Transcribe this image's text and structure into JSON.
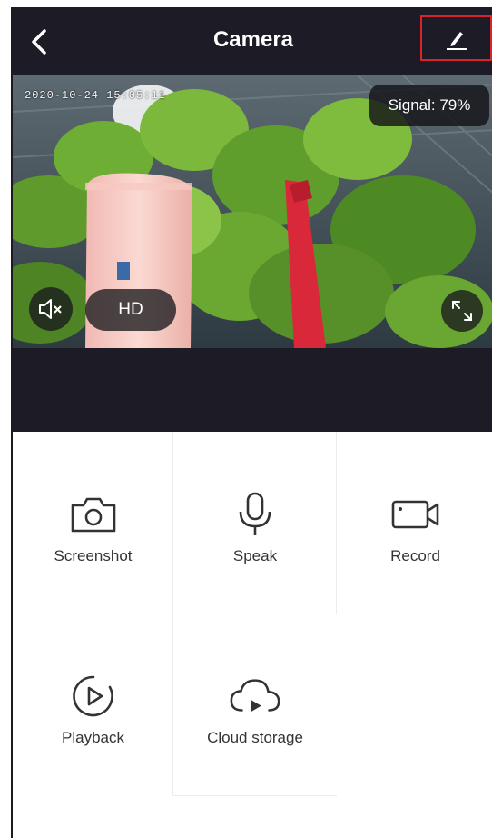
{
  "header": {
    "title": "Camera",
    "back_icon": "chevron-left-icon",
    "edit_icon": "pencil-icon"
  },
  "video": {
    "timestamp": "2020-10-24 15:05:11",
    "signal": "Signal: 79%",
    "hd_label": "HD",
    "mute_icon": "speaker-mute-icon",
    "fullscreen_icon": "fullscreen-icon"
  },
  "actions": [
    {
      "label": "Screenshot",
      "icon": "camera-icon"
    },
    {
      "label": "Speak",
      "icon": "microphone-icon"
    },
    {
      "label": "Record",
      "icon": "video-camera-icon"
    },
    {
      "label": "Playback",
      "icon": "playback-icon"
    },
    {
      "label": "Cloud storage",
      "icon": "cloud-storage-icon"
    }
  ],
  "colors": {
    "header_bg": "#1c1b26",
    "highlight": "#d8232a",
    "icon": "#333333"
  }
}
